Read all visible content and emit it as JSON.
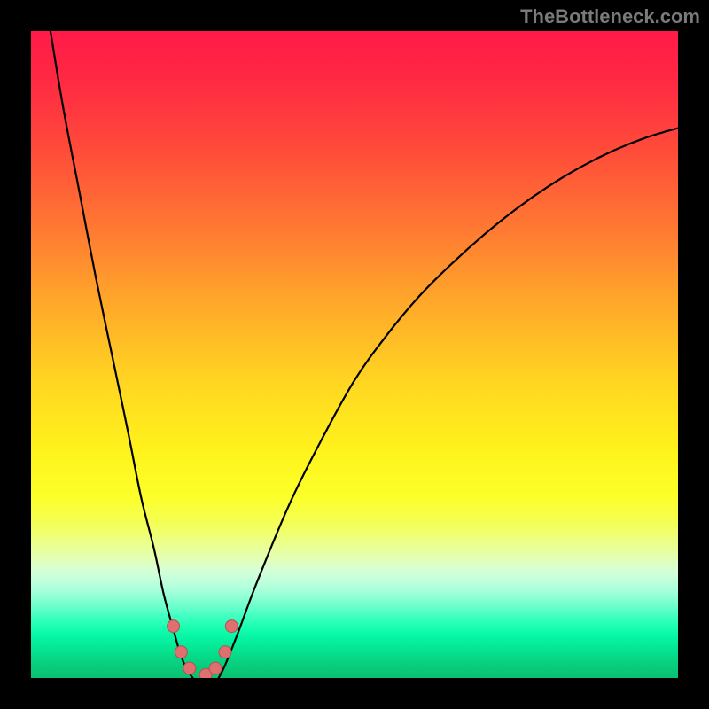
{
  "watermark": "TheBottleneck.com",
  "colors": {
    "background": "#000000",
    "curve": "#000000",
    "dot": "#e07070",
    "dot_border": "#b55050"
  },
  "chart_data": {
    "type": "line",
    "title": "",
    "xlabel": "",
    "ylabel": "",
    "xlim": [
      0,
      100
    ],
    "ylim": [
      0,
      100
    ],
    "grid": false,
    "series": [
      {
        "name": "left-branch",
        "x": [
          3,
          5,
          7.5,
          10,
          12.5,
          15,
          17,
          19,
          20.5,
          22,
          23,
          24,
          25
        ],
        "y": [
          100,
          88,
          75,
          62,
          50,
          38,
          28,
          20,
          13,
          7.5,
          4,
          1.5,
          0
        ]
      },
      {
        "name": "right-branch",
        "x": [
          29,
          30,
          32,
          35,
          40,
          45,
          50,
          55,
          60,
          65,
          70,
          75,
          80,
          85,
          90,
          95,
          100
        ],
        "y": [
          0,
          2,
          7,
          15,
          27,
          37,
          46,
          53,
          59,
          64,
          68.5,
          72.5,
          76,
          79,
          81.5,
          83.5,
          85
        ]
      }
    ],
    "marker_points": {
      "x": [
        22,
        23.2,
        24.5,
        27,
        28.5,
        30,
        31
      ],
      "y": [
        8,
        4,
        1.5,
        0.5,
        1.5,
        4,
        8
      ]
    }
  }
}
